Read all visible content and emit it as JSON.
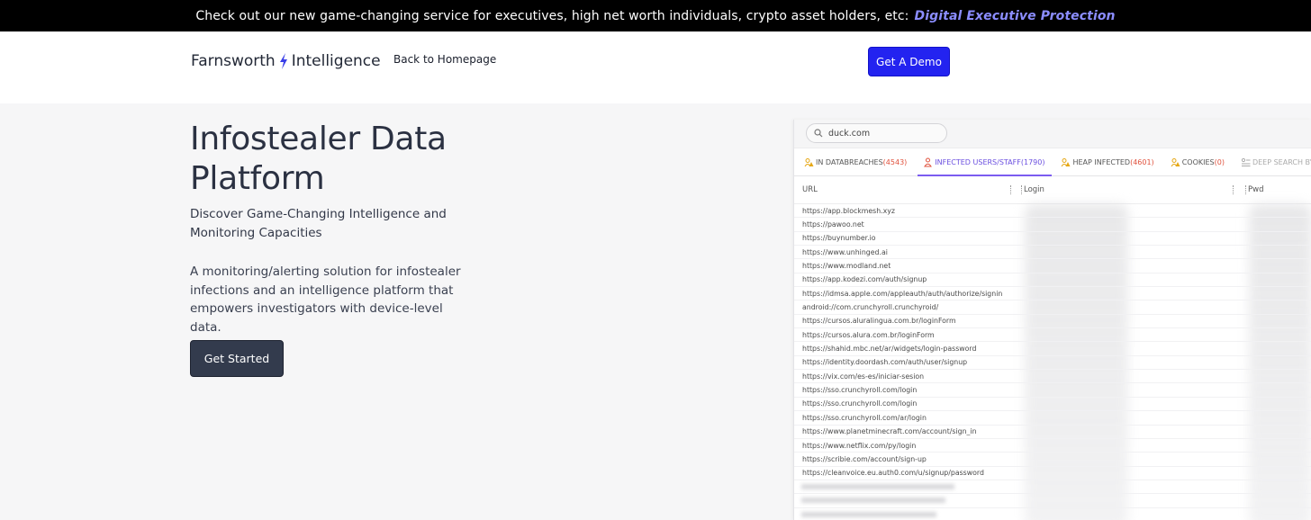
{
  "banner": {
    "text": "Check out our new game-changing service for executives, high net worth individuals, crypto asset holders, etc:",
    "link": "Digital Executive Protection"
  },
  "nav": {
    "logo_left": "Farnsworth",
    "logo_right": "Intelligence",
    "back_link": "Back to Homepage",
    "demo_button": "Get A Demo"
  },
  "hero": {
    "title": "Infostealer Data Platform",
    "subtitle": "Discover Game-Changing Intelligence and Monitoring Capacities",
    "description": "A monitoring/alerting solution for infostealer infections and an intelligence platform that empowers investigators with device-level data.",
    "cta": "Get Started"
  },
  "screenshot": {
    "search_value": "duck.com",
    "tabs": [
      {
        "label": "IN DATABREACHES",
        "count": "(4543)",
        "icon": "people-warning-icon",
        "color": "#e6a817"
      },
      {
        "label": "INFECTED USERS/STAFF",
        "count": "(1790)",
        "icon": "person-warning-icon",
        "color": "#e0513c"
      },
      {
        "label": "HEAP INFECTED",
        "count": "(4601)",
        "icon": "people-warning-icon",
        "color": "#e6a817"
      },
      {
        "label": "COOKIES",
        "count": "(0)",
        "icon": "people-warning-icon",
        "color": "#e6a817"
      },
      {
        "label": "DEEP SEARCH BY K",
        "count": "",
        "icon": "list-search-icon",
        "color": "#aaaaaa"
      }
    ],
    "columns": {
      "url": "URL",
      "login": "Login",
      "pwd": "Pwd"
    },
    "urls": [
      "https://app.blockmesh.xyz",
      "https://pawoo.net",
      "https://buynumber.io",
      "https://www.unhinged.ai",
      "https://www.modland.net",
      "https://app.kodezi.com/auth/signup",
      "https://idmsa.apple.com/appleauth/auth/authorize/signin",
      "android://com.crunchyroll.crunchyroid/",
      "https://cursos.aluralingua.com.br/loginForm",
      "https://cursos.alura.com.br/loginForm",
      "https://shahid.mbc.net/ar/widgets/login-password",
      "https://identity.doordash.com/auth/user/signup",
      "https://vix.com/es-es/iniciar-sesion",
      "https://sso.crunchyroll.com/login",
      "https://sso.crunchyroll.com/login",
      "https://sso.crunchyroll.com/ar/login",
      "https://www.planetminecraft.com/account/sign_in",
      "https://www.netflix.com/py/login",
      "https://scribie.com/account/sign-up",
      "https://cleanvoice.eu.auth0.com/u/signup/password"
    ]
  }
}
